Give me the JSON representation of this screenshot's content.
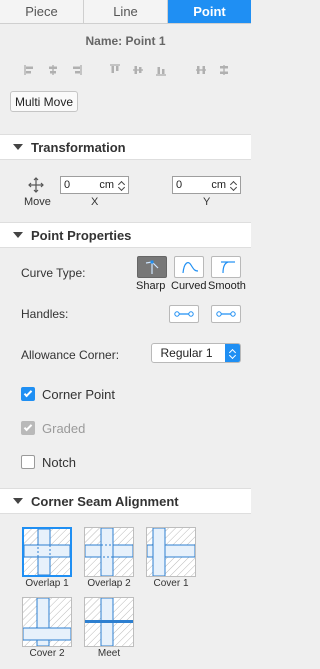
{
  "tabs": [
    "Piece",
    "Line",
    "Point"
  ],
  "active_tab": "Point",
  "name_label": "Name: Point 1",
  "alignment_icons": [
    "align-left-icon",
    "align-center-horizontal-icon",
    "align-right-icon",
    "align-top-icon",
    "align-center-vertical-icon",
    "align-bottom-icon",
    "distribute-horizontal-icon",
    "distribute-vertical-icon"
  ],
  "multi_move_label": "Multi Move",
  "sections": {
    "transformation": "Transformation",
    "point_properties": "Point Properties",
    "corner_seam": "Corner Seam Alignment"
  },
  "transformation": {
    "move_label": "Move",
    "x_label": "X",
    "y_label": "Y",
    "x_value": "0",
    "y_value": "0",
    "unit": "cm"
  },
  "point_properties": {
    "curve_type_label": "Curve Type:",
    "curve_types": [
      "Sharp",
      "Curved",
      "Smooth"
    ],
    "active_curve_type": "Sharp",
    "handles_label": "Handles:",
    "allowance_corner_label": "Allowance Corner:",
    "allowance_corner_value": "Regular 1",
    "checkboxes": [
      {
        "label": "Corner Point",
        "checked": true,
        "disabled": false
      },
      {
        "label": "Graded",
        "checked": true,
        "disabled": true
      },
      {
        "label": "Notch",
        "checked": false,
        "disabled": false
      }
    ]
  },
  "corner_seam": {
    "options": [
      "Overlap 1",
      "Overlap 2",
      "Cover 1",
      "Cover 2",
      "Meet"
    ],
    "selected": "Overlap 1"
  },
  "colors": {
    "accent": "#1f8ff3",
    "panel_bg": "#efefef",
    "header_bg": "#ffffff",
    "active_curve_bg": "#777777"
  }
}
